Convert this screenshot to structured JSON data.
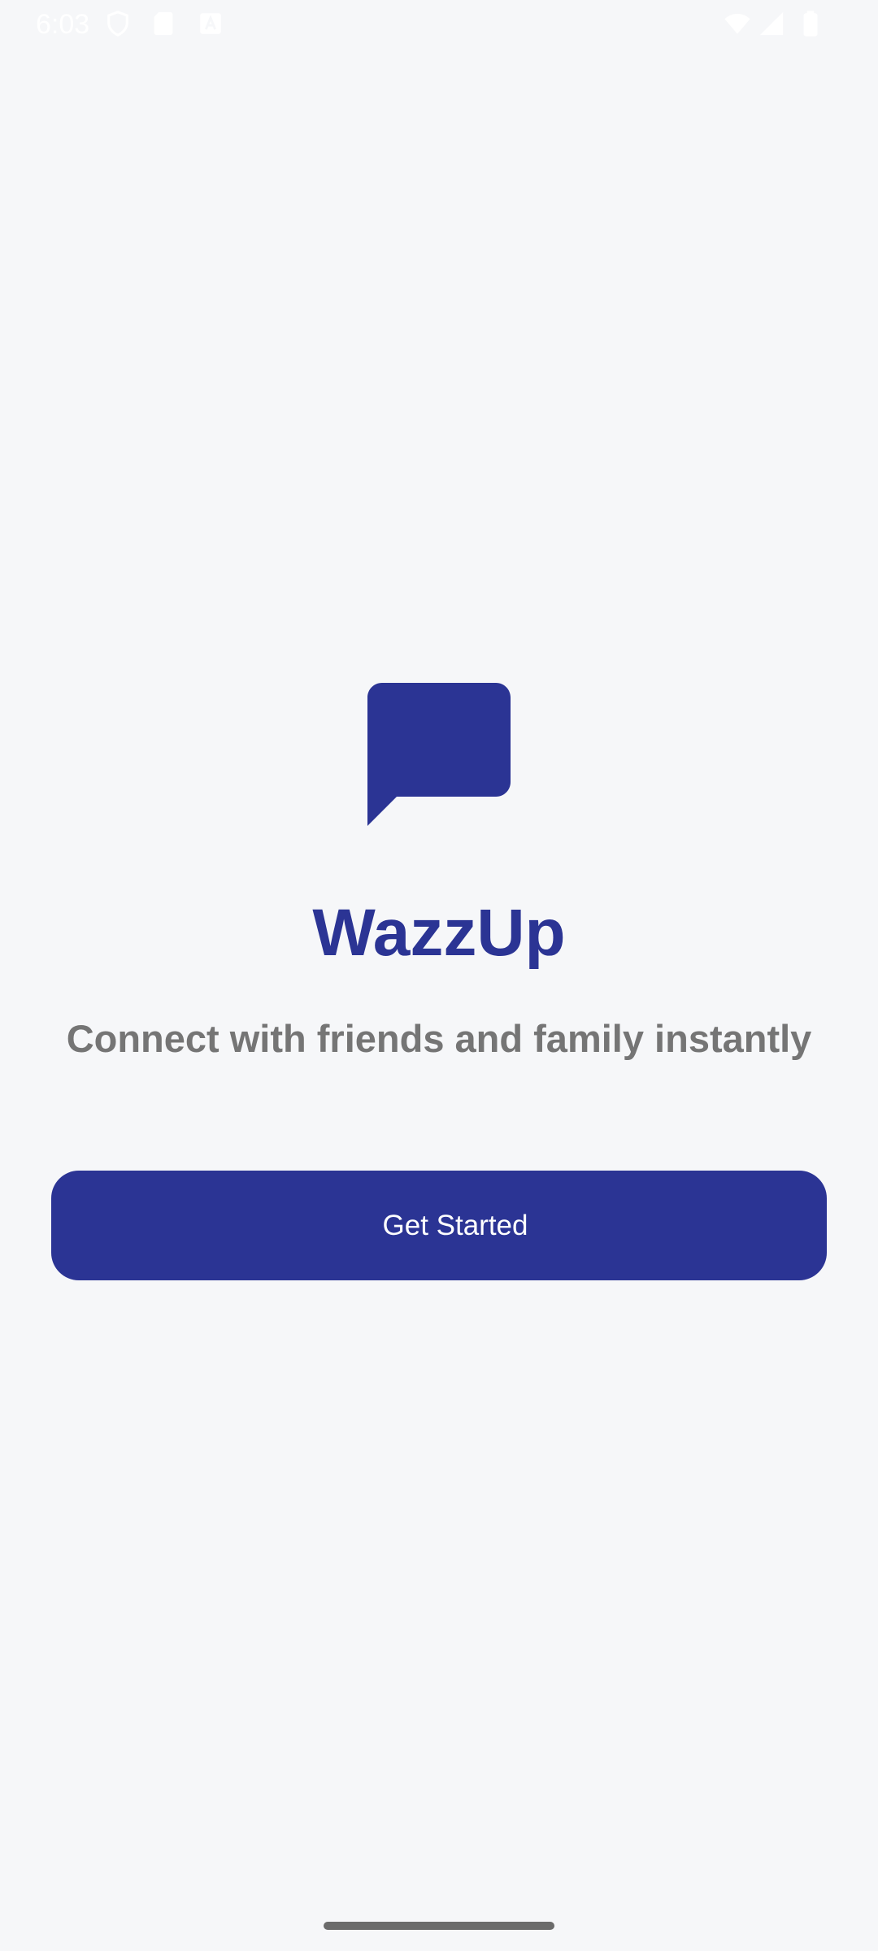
{
  "status_bar": {
    "time": "6:03",
    "left_icons": [
      "shield-icon",
      "sim-card-icon",
      "font-icon"
    ],
    "right_icons": [
      "wifi-icon",
      "signal-icon",
      "battery-icon"
    ]
  },
  "app": {
    "logo_icon": "chat-bubble-icon",
    "title": "WazzUp",
    "tagline": "Connect with friends and family instantly",
    "get_started_label": "Get Started"
  },
  "colors": {
    "primary": "#2B3494",
    "background": "#F6F7F9",
    "tagline_text": "#757575",
    "button_text": "#FFFFFF"
  }
}
